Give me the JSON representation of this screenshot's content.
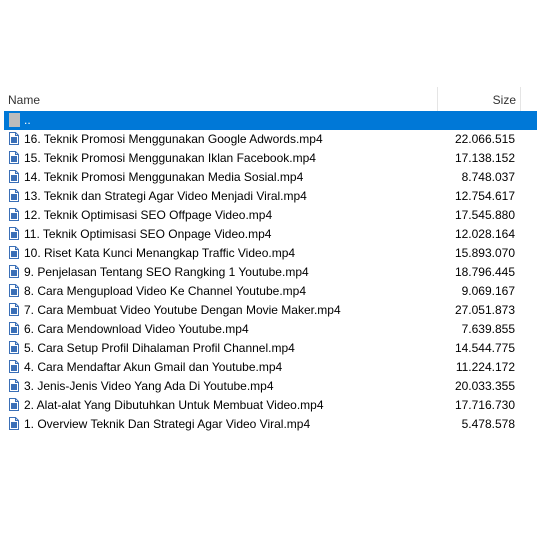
{
  "columns": {
    "name": "Name",
    "size": "Size"
  },
  "colors": {
    "selection": "#0078d7",
    "icon_blue": "#3a6fb7"
  },
  "parent_row": {
    "label": "..",
    "icon": "folder-up-icon"
  },
  "files": [
    {
      "name": "16. Teknik Promosi Menggunakan Google Adwords.mp4",
      "size": "22.066.515",
      "icon": "file-icon"
    },
    {
      "name": "15. Teknik Promosi Menggunakan Iklan Facebook.mp4",
      "size": "17.138.152",
      "icon": "file-icon"
    },
    {
      "name": "14. Teknik Promosi Menggunakan Media Sosial.mp4",
      "size": "8.748.037",
      "icon": "file-icon"
    },
    {
      "name": "13. Teknik dan Strategi Agar Video Menjadi Viral.mp4",
      "size": "12.754.617",
      "icon": "file-icon"
    },
    {
      "name": "12. Teknik Optimisasi SEO Offpage Video.mp4",
      "size": "17.545.880",
      "icon": "file-icon"
    },
    {
      "name": "11. Teknik Optimisasi SEO Onpage Video.mp4",
      "size": "12.028.164",
      "icon": "file-icon"
    },
    {
      "name": "10. Riset Kata Kunci Menangkap Traffic Video.mp4",
      "size": "15.893.070",
      "icon": "file-icon"
    },
    {
      "name": "9. Penjelasan Tentang SEO Rangking 1 Youtube.mp4",
      "size": "18.796.445",
      "icon": "file-icon"
    },
    {
      "name": "8. Cara Mengupload Video Ke Channel Youtube.mp4",
      "size": "9.069.167",
      "icon": "file-icon"
    },
    {
      "name": "7. Cara Membuat Video Youtube Dengan Movie Maker.mp4",
      "size": "27.051.873",
      "icon": "file-icon"
    },
    {
      "name": "6. Cara Mendownload Video Youtube.mp4",
      "size": "7.639.855",
      "icon": "file-icon"
    },
    {
      "name": "5. Cara Setup Profil Dihalaman Profil Channel.mp4",
      "size": "14.544.775",
      "icon": "file-icon"
    },
    {
      "name": "4. Cara Mendaftar Akun Gmail dan Youtube.mp4",
      "size": "11.224.172",
      "icon": "file-icon"
    },
    {
      "name": "3. Jenis-Jenis Video Yang Ada Di Youtube.mp4",
      "size": "20.033.355",
      "icon": "file-icon"
    },
    {
      "name": "2. Alat-alat Yang Dibutuhkan Untuk Membuat Video.mp4",
      "size": "17.716.730",
      "icon": "file-icon"
    },
    {
      "name": "1. Overview Teknik Dan Strategi Agar Video Viral.mp4",
      "size": "5.478.578",
      "icon": "file-icon"
    }
  ]
}
